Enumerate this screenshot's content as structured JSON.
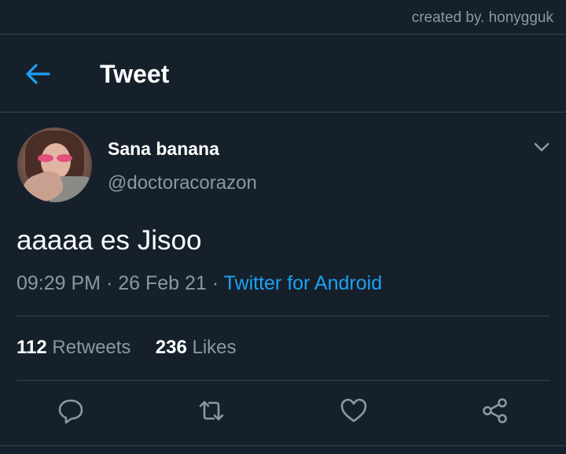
{
  "watermark": "created by. honygguk",
  "header": {
    "title": "Tweet"
  },
  "author": {
    "display_name": "Sana banana",
    "handle": "@doctoracorazon"
  },
  "tweet": {
    "text": "aaaaa es Jisoo",
    "time": "09:29 PM",
    "date": "26 Feb 21",
    "separator": "·",
    "source": "Twitter for Android"
  },
  "stats": {
    "retweets_count": "112",
    "retweets_label": "Retweets",
    "likes_count": "236",
    "likes_label": "Likes"
  },
  "actions": [
    "reply-icon",
    "retweet-icon",
    "like-icon",
    "share-icon"
  ],
  "colors": {
    "background": "#15202b",
    "accent": "#1da1f2",
    "muted": "#8899a6",
    "divider": "#38444d"
  }
}
